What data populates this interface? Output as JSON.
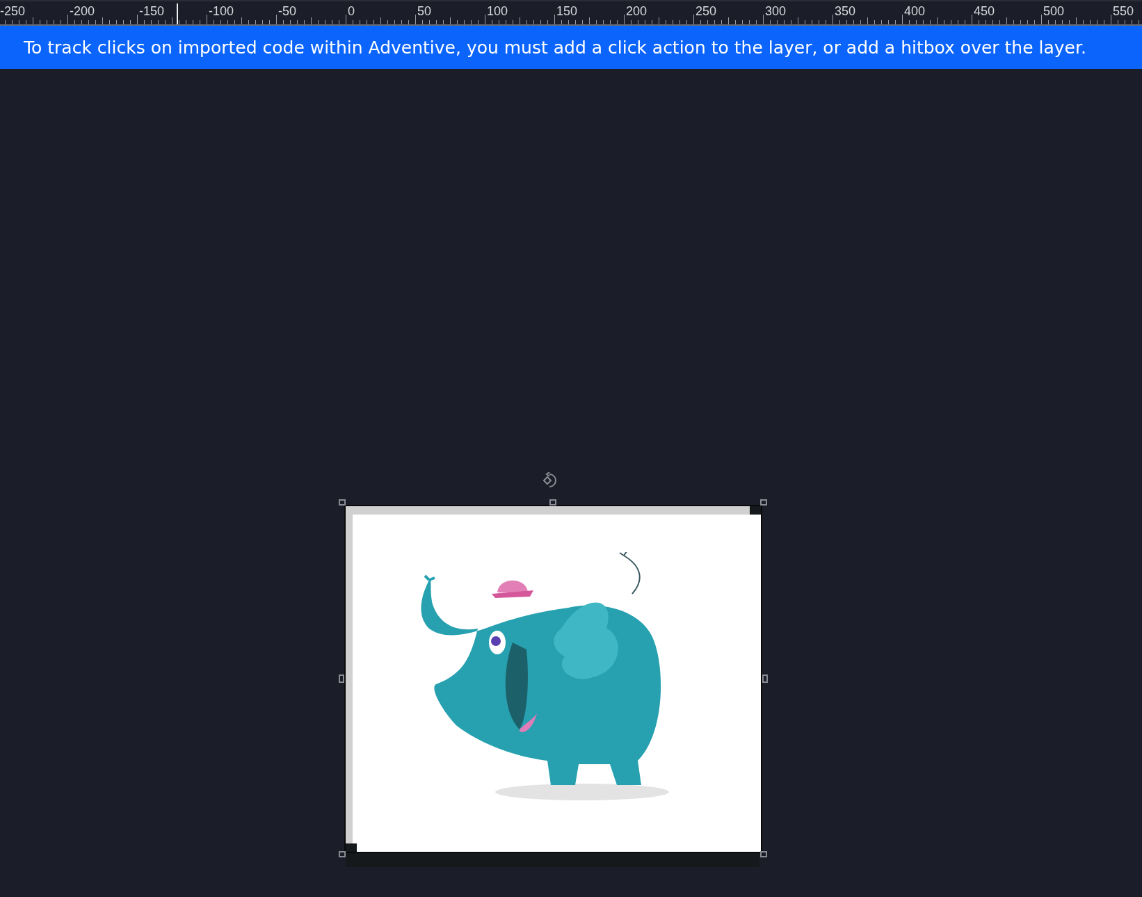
{
  "ruler": {
    "labels": [
      "-250",
      "-200",
      "-150",
      "-100",
      "-50",
      "0",
      "50",
      "100",
      "150",
      "200",
      "250",
      "300",
      "350",
      "400",
      "450",
      "500",
      "550"
    ]
  },
  "banner": {
    "text": "To track clicks on imported code within Adventive, you must add a click action to the layer, or add a hitbox over the layer."
  },
  "layer": {
    "selected": true
  }
}
